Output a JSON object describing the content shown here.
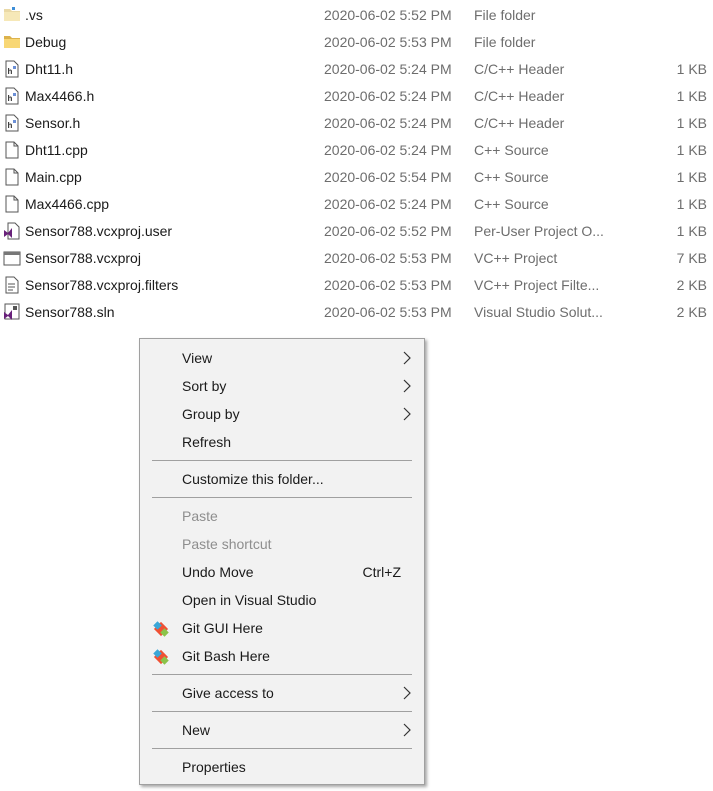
{
  "files": [
    {
      "name": ".vs",
      "date": "2020-06-02 5:52 PM",
      "type": "File folder",
      "size": "",
      "icon": "folder-hidden-icon"
    },
    {
      "name": "Debug",
      "date": "2020-06-02 5:53 PM",
      "type": "File folder",
      "size": "",
      "icon": "folder-icon"
    },
    {
      "name": "Dht11.h",
      "date": "2020-06-02 5:24 PM",
      "type": "C/C++ Header",
      "size": "1 KB",
      "icon": "header-file-icon"
    },
    {
      "name": "Max4466.h",
      "date": "2020-06-02 5:24 PM",
      "type": "C/C++ Header",
      "size": "1 KB",
      "icon": "header-file-icon"
    },
    {
      "name": "Sensor.h",
      "date": "2020-06-02 5:24 PM",
      "type": "C/C++ Header",
      "size": "1 KB",
      "icon": "header-file-icon"
    },
    {
      "name": "Dht11.cpp",
      "date": "2020-06-02 5:24 PM",
      "type": "C++ Source",
      "size": "1 KB",
      "icon": "source-file-icon"
    },
    {
      "name": "Main.cpp",
      "date": "2020-06-02 5:54 PM",
      "type": "C++ Source",
      "size": "1 KB",
      "icon": "source-file-icon"
    },
    {
      "name": "Max4466.cpp",
      "date": "2020-06-02 5:24 PM",
      "type": "C++ Source",
      "size": "1 KB",
      "icon": "source-file-icon"
    },
    {
      "name": "Sensor788.vcxproj.user",
      "date": "2020-06-02 5:52 PM",
      "type": "Per-User Project O...",
      "size": "1 KB",
      "icon": "vs-user-file-icon"
    },
    {
      "name": "Sensor788.vcxproj",
      "date": "2020-06-02 5:53 PM",
      "type": "VC++ Project",
      "size": "7 KB",
      "icon": "vcxproj-file-icon"
    },
    {
      "name": "Sensor788.vcxproj.filters",
      "date": "2020-06-02 5:53 PM",
      "type": "VC++ Project Filte...",
      "size": "2 KB",
      "icon": "filters-file-icon"
    },
    {
      "name": "Sensor788.sln",
      "date": "2020-06-02 5:53 PM",
      "type": "Visual Studio Solut...",
      "size": "2 KB",
      "icon": "sln-file-icon"
    }
  ],
  "menu": {
    "view": "View",
    "sort_by": "Sort by",
    "group_by": "Group by",
    "refresh": "Refresh",
    "customize": "Customize this folder...",
    "paste": "Paste",
    "paste_shortcut": "Paste shortcut",
    "undo_move": "Undo Move",
    "undo_move_shortcut": "Ctrl+Z",
    "open_vs": "Open in Visual Studio",
    "git_gui": "Git GUI Here",
    "git_bash": "Git Bash Here",
    "give_access": "Give access to",
    "new": "New",
    "properties": "Properties"
  },
  "colors": {
    "menu_bg": "#f2f2f2",
    "menu_border": "#a0a0a0",
    "disabled_text": "#8e8e8e",
    "secondary_text": "#6d6d6d",
    "folder_yellow": "#f8d775",
    "vs_purple": "#68217a",
    "git_orange": "#f05033"
  }
}
